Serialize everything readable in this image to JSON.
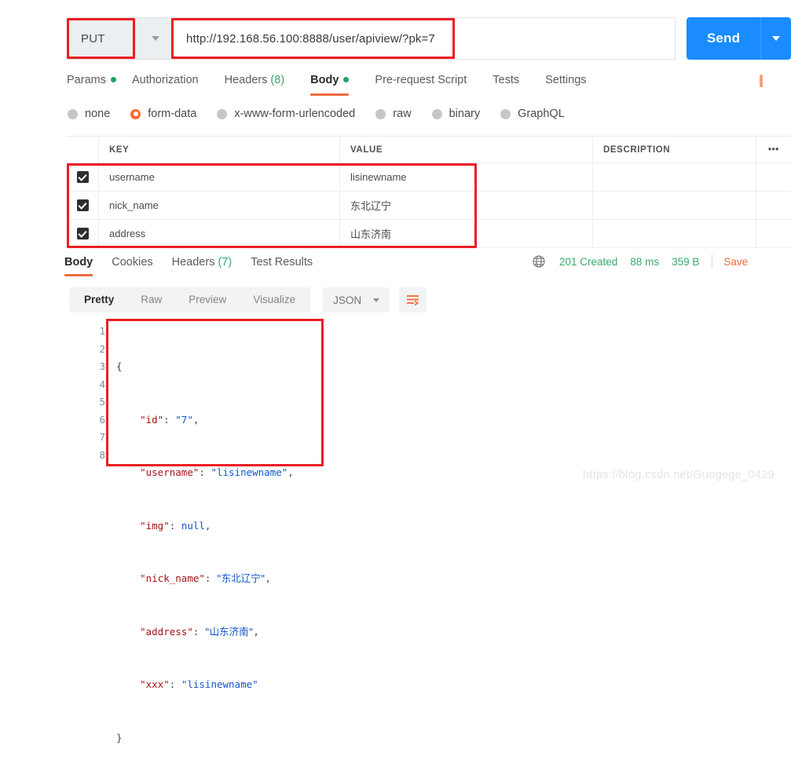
{
  "request": {
    "method": "PUT",
    "url": "http://192.168.56.100:8888/user/apiview/?pk=7",
    "send_label": "Send",
    "tabs": [
      {
        "label": "Params",
        "dot": true,
        "count": null,
        "active": false
      },
      {
        "label": "Authorization",
        "dot": false,
        "count": null,
        "active": false
      },
      {
        "label": "Headers",
        "dot": false,
        "count": "(8)",
        "active": false
      },
      {
        "label": "Body",
        "dot": true,
        "count": null,
        "active": true
      },
      {
        "label": "Pre-request Script",
        "dot": false,
        "count": null,
        "active": false
      },
      {
        "label": "Tests",
        "dot": false,
        "count": null,
        "active": false
      },
      {
        "label": "Settings",
        "dot": false,
        "count": null,
        "active": false
      }
    ],
    "body_types": [
      {
        "label": "none",
        "selected": false
      },
      {
        "label": "form-data",
        "selected": true
      },
      {
        "label": "x-www-form-urlencoded",
        "selected": false
      },
      {
        "label": "raw",
        "selected": false
      },
      {
        "label": "binary",
        "selected": false
      },
      {
        "label": "GraphQL",
        "selected": false
      }
    ],
    "form_table": {
      "columns": [
        "KEY",
        "VALUE",
        "DESCRIPTION"
      ],
      "more_menu": "•••",
      "rows": [
        {
          "checked": true,
          "key": "username",
          "value": "lisinewname",
          "description": ""
        },
        {
          "checked": true,
          "key": "nick_name",
          "value": "东北辽宁",
          "description": ""
        },
        {
          "checked": true,
          "key": "address",
          "value": "山东济南",
          "description": ""
        }
      ]
    }
  },
  "response": {
    "tabs": [
      {
        "label": "Body",
        "count": null,
        "active": true
      },
      {
        "label": "Cookies",
        "count": null,
        "active": false
      },
      {
        "label": "Headers",
        "count": "(7)",
        "active": false
      },
      {
        "label": "Test Results",
        "count": null,
        "active": false
      }
    ],
    "status": "201 Created",
    "time": "88 ms",
    "size": "359 B",
    "save_label": "Save",
    "view_modes": [
      {
        "label": "Pretty",
        "active": true
      },
      {
        "label": "Raw",
        "active": false
      },
      {
        "label": "Preview",
        "active": false
      },
      {
        "label": "Visualize",
        "active": false
      }
    ],
    "format": "JSON",
    "line_numbers": [
      "1",
      "2",
      "3",
      "4",
      "5",
      "6",
      "7",
      "8"
    ],
    "json_body": {
      "id": "7",
      "username": "lisinewname",
      "img": null,
      "nick_name": "东北辽宁",
      "address": "山东济南",
      "xxx": "lisinewname"
    }
  },
  "watermark": "https://blog.csdn.net/Guogege_0429",
  "colors": {
    "send_blue": "#1a8cff",
    "accent_orange": "#ef6c3e",
    "status_green": "#3aa76d",
    "annotation_red": "#ed1c24",
    "radio_selected": "#ff6b35"
  }
}
